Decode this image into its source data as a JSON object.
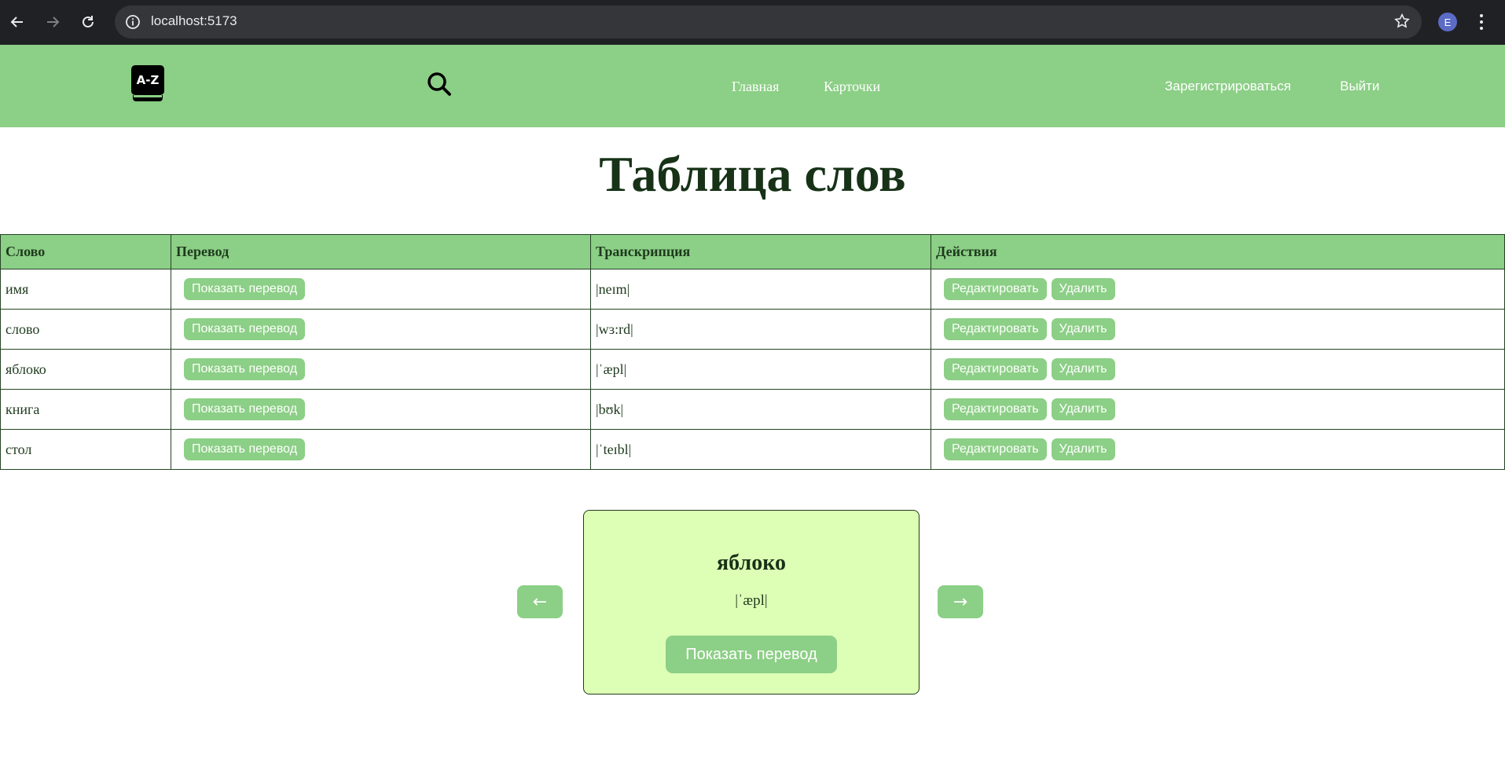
{
  "browser": {
    "url": "localhost:5173",
    "profile_initial": "E",
    "icons": [
      "back-arrow-icon",
      "forward-arrow-icon",
      "reload-icon",
      "info-icon",
      "star-icon",
      "kebab-menu-icon"
    ]
  },
  "header": {
    "logo_text": "A-Z",
    "nav": {
      "home": "Главная",
      "cards": "Карточки"
    },
    "register": "Зарегистрироваться",
    "logout": "Выйти",
    "colors": {
      "header_bg": "#8ccf86",
      "link": "#ffffff"
    }
  },
  "page": {
    "title": "Таблица слов"
  },
  "table": {
    "columns": [
      "Слово",
      "Перевод",
      "Транскрипция",
      "Действия"
    ],
    "show_translation_label": "Показать перевод",
    "edit_label": "Редактировать",
    "delete_label": "Удалить",
    "rows": [
      {
        "word": "имя",
        "transcription": "|neɪm|"
      },
      {
        "word": "слово",
        "transcription": "|wɜ:rd|"
      },
      {
        "word": "яблоко",
        "transcription": "|ˈæpl|"
      },
      {
        "word": "книга",
        "transcription": "|bʊk|"
      },
      {
        "word": "стол",
        "transcription": "|ˈteɪbl|"
      }
    ]
  },
  "flashcard": {
    "prev": "←",
    "next": "→",
    "word": "яблоко",
    "transcription": "|ˈæpl|",
    "button": "Показать перевод",
    "colors": {
      "card_bg": "#ddffb5",
      "accent": "#8ccf86"
    }
  }
}
